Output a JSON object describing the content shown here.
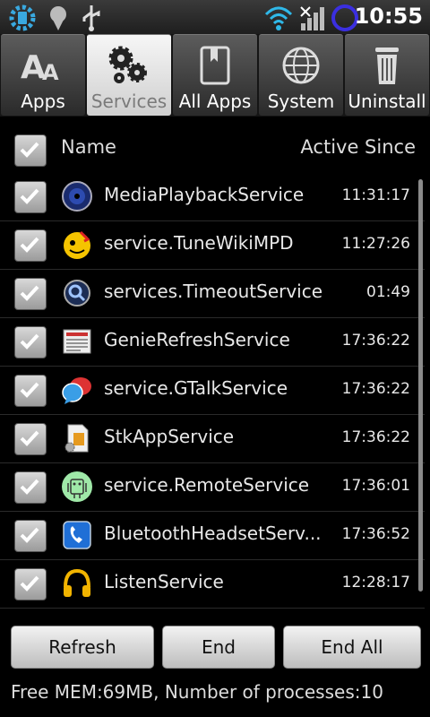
{
  "status_bar": {
    "time": "10:55",
    "icons": [
      "settings-icon",
      "location-icon",
      "usb-icon",
      "wifi-icon",
      "signal-icon",
      "sync-icon"
    ]
  },
  "tabs": [
    {
      "label": "Apps",
      "icon": "font-icon",
      "active": false
    },
    {
      "label": "Services",
      "icon": "gears-icon",
      "active": true
    },
    {
      "label": "All Apps",
      "icon": "book-icon",
      "active": false
    },
    {
      "label": "System",
      "icon": "globe-icon",
      "active": false
    },
    {
      "label": "Uninstall",
      "icon": "trash-icon",
      "active": false
    }
  ],
  "list_header": {
    "name": "Name",
    "active_since": "Active Since"
  },
  "services": [
    {
      "name": "MediaPlaybackService",
      "time": "11:31:17",
      "icon": "speaker-icon"
    },
    {
      "name": "service.TuneWikiMPD",
      "time": "11:27:26",
      "icon": "tunewiki-icon"
    },
    {
      "name": "services.TimeoutService",
      "time": "01:49",
      "icon": "search-app-icon"
    },
    {
      "name": "GenieRefreshService",
      "time": "17:36:22",
      "icon": "news-icon"
    },
    {
      "name": "service.GTalkService",
      "time": "17:36:22",
      "icon": "chat-bubbles-icon"
    },
    {
      "name": "StkAppService",
      "time": "17:36:22",
      "icon": "sim-toolkit-icon"
    },
    {
      "name": "service.RemoteService",
      "time": "17:36:01",
      "icon": "android-robot-icon"
    },
    {
      "name": "BluetoothHeadsetServ...",
      "time": "17:36:52",
      "icon": "phone-icon"
    },
    {
      "name": "ListenService",
      "time": "12:28:17",
      "icon": "headphones-icon"
    }
  ],
  "buttons": {
    "refresh": "Refresh",
    "end": "End",
    "end_all": "End All"
  },
  "footer": "Free MEM:69MB,  Number of processes:10",
  "colors": {
    "background": "#000000",
    "tab_active": "#e8e8e8",
    "button": "#dcdcdc"
  }
}
